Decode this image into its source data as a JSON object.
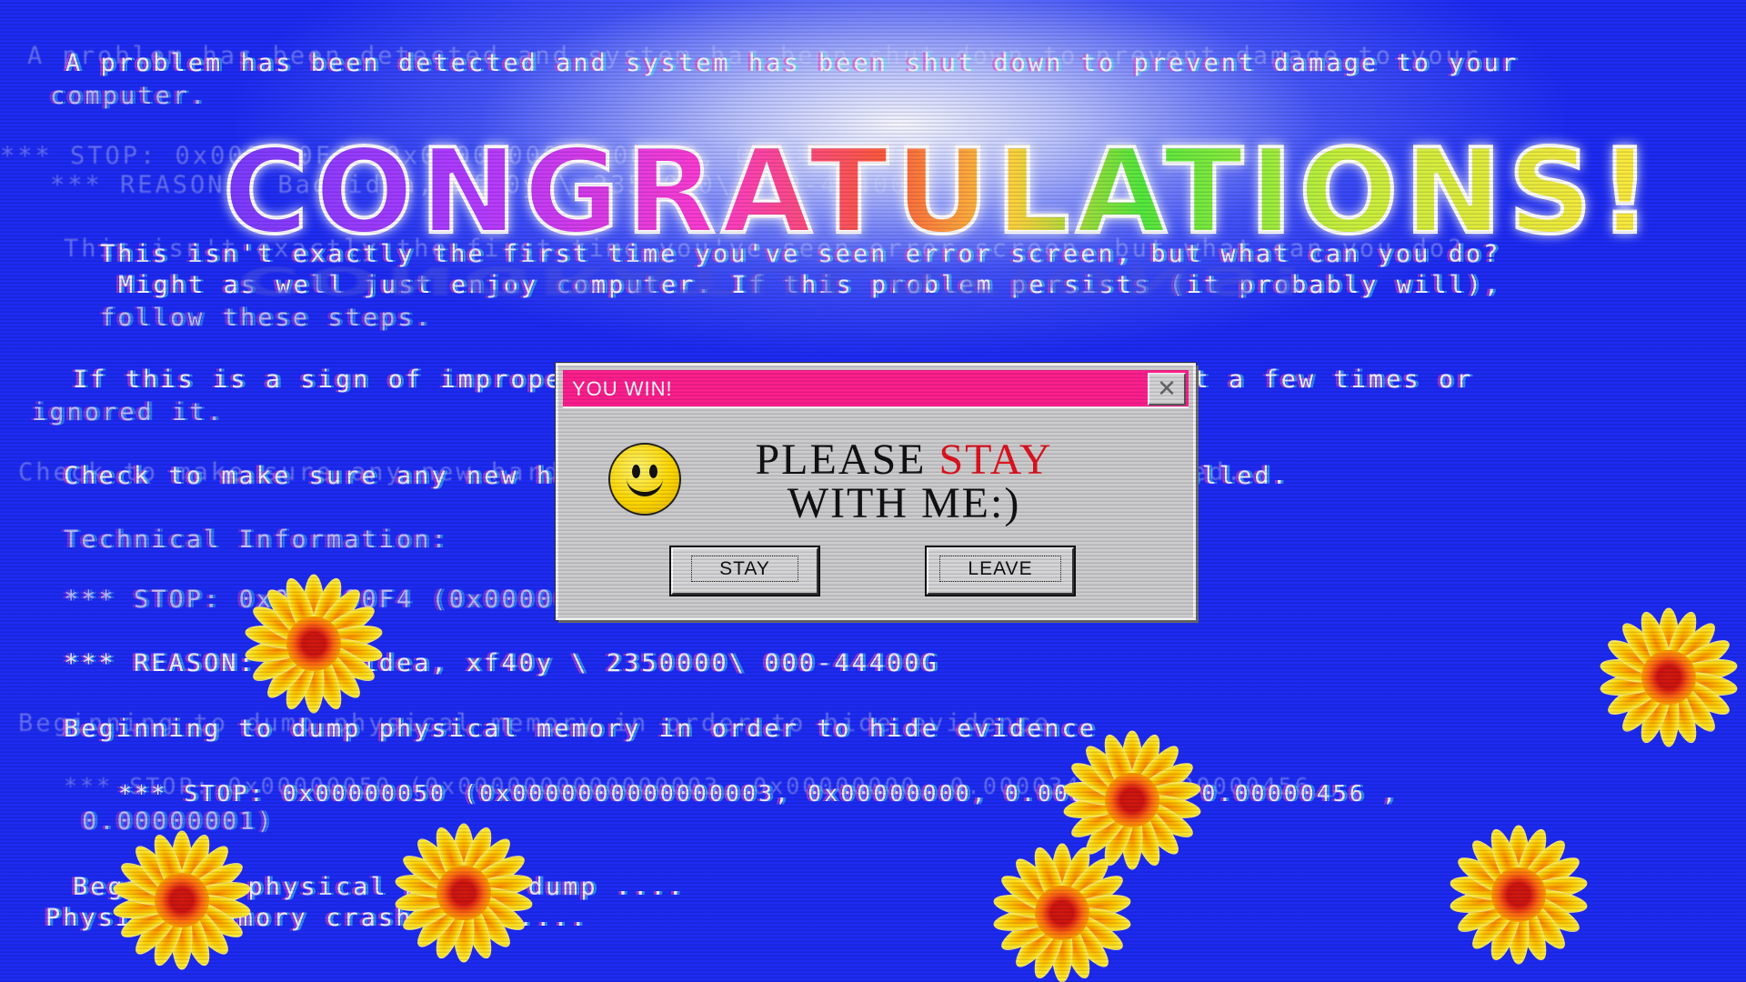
{
  "background": {
    "color": "#1d2bf2"
  },
  "headline": "CONGRATULATIONS!",
  "bsod_lines": [
    "A problem has been detected and system has been shut down to prevent damage to your",
    "computer.",
    "This isn't exactly the first time you've seen error screen, but what can you do?",
    "Might as well just enjoy computer. If this problem persists (it probably will),",
    "follow these steps.",
    "If this is a sign of improper operation, you've probably tried it a few times or",
    "ignored it.",
    "Check to make sure any new hardware or software is properly installed.",
    "Technical Information:",
    "*** STOP: 0x000000F4 (0x0000000000000003, 0x23777ad0)",
    "*** REASON:  Bad idea, xf40y \\ 2350000\\ 000-44400G",
    "Beginning to dump physical memory in order to hide evidence",
    "*** STOP: 0x00000050 (0x0000000000000003, 0x00000000, 0.00003446, 0.00000456 ,",
    "0.00000001)",
    "Beginning physical memory dump ....",
    "Physical memory crash dump ...."
  ],
  "dialog": {
    "title": "YOU WIN!",
    "message_1": "PLEASE ",
    "message_stay": "STAY",
    "message_2": "WITH ME:)",
    "stay_button": "STAY",
    "leave_button": "LEAVE",
    "close_icon": "close-icon",
    "title_bar_color": "#ff1f8c"
  },
  "decorations": {
    "flower_icon": "sunflower-icon",
    "smiley_icon": "smiley-face-icon"
  }
}
